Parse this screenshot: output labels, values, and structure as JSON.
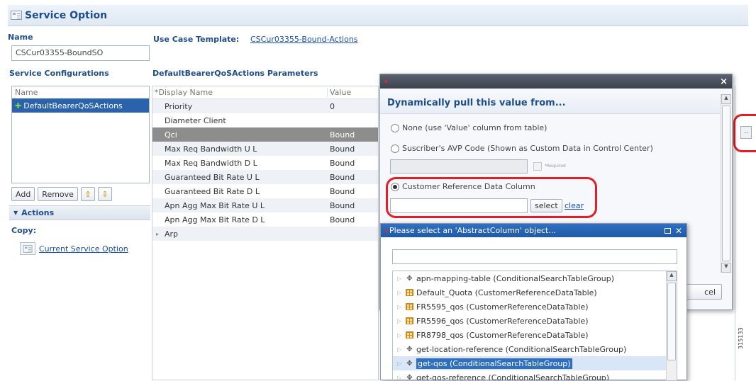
{
  "header": {
    "title": "Service Option"
  },
  "name_section": {
    "label": "Name",
    "value": "CSCur03355-BoundSO"
  },
  "use_case": {
    "label": "Use Case Template:",
    "link": "CSCur03355-Bound-Actions"
  },
  "service_configurations": {
    "label": "Service Configurations",
    "column_header": "Name",
    "items": [
      "DefaultBearerQoSActions"
    ],
    "add_label": "Add",
    "remove_label": "Remove"
  },
  "actions": {
    "label": "Actions",
    "copy_label": "Copy:",
    "copy_link": "Current Service Option"
  },
  "params": {
    "label": "DefaultBearerQoSActions Parameters",
    "col_display": "*Display Name",
    "col_value": "Value",
    "rows": [
      {
        "name": "Priority",
        "value": "0"
      },
      {
        "name": "Diameter Client",
        "value": ""
      },
      {
        "name": "Qci",
        "value": "Bound"
      },
      {
        "name": "Max Req Bandwidth U L",
        "value": "Bound"
      },
      {
        "name": "Max Req Bandwidth D L",
        "value": "Bound"
      },
      {
        "name": "Guaranteed Bit Rate U L",
        "value": "Bound"
      },
      {
        "name": "Guaranteed Bit Rate D L",
        "value": "Bound"
      },
      {
        "name": "Apn Agg Max Bit Rate U L",
        "value": "Bound"
      },
      {
        "name": "Apn Agg Max Bit Rate D L",
        "value": "Bound"
      },
      {
        "name": "Arp",
        "value": ""
      }
    ]
  },
  "pull_dialog": {
    "close_glyph": "×",
    "heading": "Dynamically pull this value from...",
    "opt_none": "None (use 'Value' column from table)",
    "opt_avp": "Suscriber's AVP Code (Shown as Custom Data in Control Center)",
    "required": "*Required",
    "opt_crd": "Customer Reference Data Column",
    "select_label": "select",
    "clear_label": "clear",
    "cancel_fragment": "cel"
  },
  "select_dialog": {
    "title": "Please select an 'AbstractColumn' object...",
    "items": [
      {
        "label": "apn-mapping-table (ConditionalSearchTableGroup)",
        "icon": "group-icon"
      },
      {
        "label": "Default_Quota (CustomerReferenceDataTable)",
        "icon": "table-icon"
      },
      {
        "label": "FR5595_qos (CustomerReferenceDataTable)",
        "icon": "table-icon"
      },
      {
        "label": "FR5596_qos (CustomerReferenceDataTable)",
        "icon": "table-icon"
      },
      {
        "label": "FR8798_qos (CustomerReferenceDataTable)",
        "icon": "table-icon"
      },
      {
        "label": "get-location-reference (ConditionalSearchTableGroup)",
        "icon": "group-icon"
      },
      {
        "label": "get-qos (ConditionalSearchTableGroup)",
        "icon": "group-icon",
        "selected": true
      },
      {
        "label": "get-qos-reference (ConditionalSearchTableGroup)",
        "icon": "group-icon"
      }
    ]
  },
  "side_id": "315133",
  "colors": {
    "title": "#1f4e8c",
    "highlight_red": "#e41e26",
    "row_selected": "#8d8d8d",
    "tree_selected": "#d8e6f7"
  }
}
